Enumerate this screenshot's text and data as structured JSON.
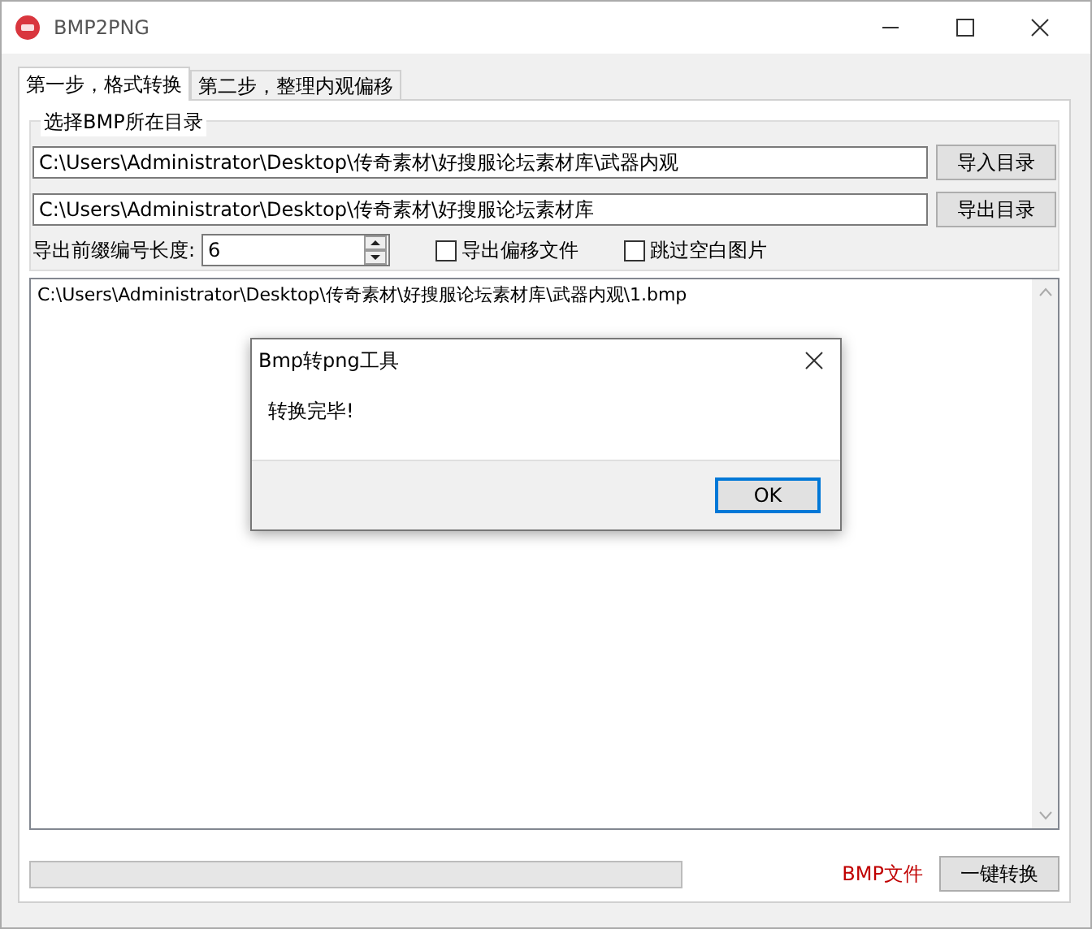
{
  "window": {
    "title": "BMP2PNG"
  },
  "tabs": [
    {
      "label": "第一步，格式转换",
      "selected": true
    },
    {
      "label": "第二步，整理内观偏移",
      "selected": false
    }
  ],
  "group": {
    "title": "选择BMP所在目录"
  },
  "paths": [
    {
      "value": "C:\\Users\\Administrator\\Desktop\\传奇素材\\好搜服论坛素材库\\武器内观",
      "button": "导入目录"
    },
    {
      "value": "C:\\Users\\Administrator\\Desktop\\传奇素材\\好搜服论坛素材库",
      "button": "导出目录"
    }
  ],
  "prefix": {
    "label": "导出前缀编号长度:",
    "value": "6"
  },
  "options": [
    {
      "label": "导出偏移文件",
      "checked": false
    },
    {
      "label": "跳过空白图片",
      "checked": false
    }
  ],
  "list": {
    "items": [
      "C:\\Users\\Administrator\\Desktop\\传奇素材\\好搜服论坛素材库\\武器内观\\1.bmp"
    ]
  },
  "progress": {
    "level": 0
  },
  "status": "BMP文件",
  "convert_button": "一键转换",
  "dialog": {
    "title": "Bmp转png工具",
    "message": "转换完毕!",
    "button": "OK"
  }
}
